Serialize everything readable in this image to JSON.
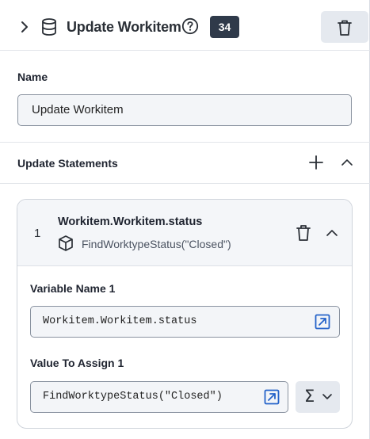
{
  "header": {
    "title": "Update Workitem",
    "badge_count": "34"
  },
  "name_field": {
    "label": "Name",
    "value": "Update Workitem"
  },
  "update_statements": {
    "label": "Update Statements",
    "items": [
      {
        "index": "1",
        "title": "Workitem.Workitem.status",
        "subtitle": "FindWorktypeStatus(\"Closed\")",
        "variable_label": "Variable Name 1",
        "variable_value": "Workitem.Workitem.status",
        "value_label": "Value To Assign 1",
        "value_value": "FindWorktypeStatus(\"Closed\")"
      }
    ]
  },
  "icons": {
    "expand": "chevron-right-icon",
    "database": "database-icon",
    "help": "help-circle-icon",
    "delete": "trash-icon",
    "add": "plus-icon",
    "collapse": "chevron-up-icon",
    "data_type": "cube-icon",
    "open_editor": "open-external-icon",
    "expression": "sigma-icon",
    "dropdown": "chevron-down-icon"
  },
  "colors": {
    "badge_bg": "#2f3a4a",
    "accent": "#2563c9",
    "button_bg": "#e5e9ef"
  }
}
